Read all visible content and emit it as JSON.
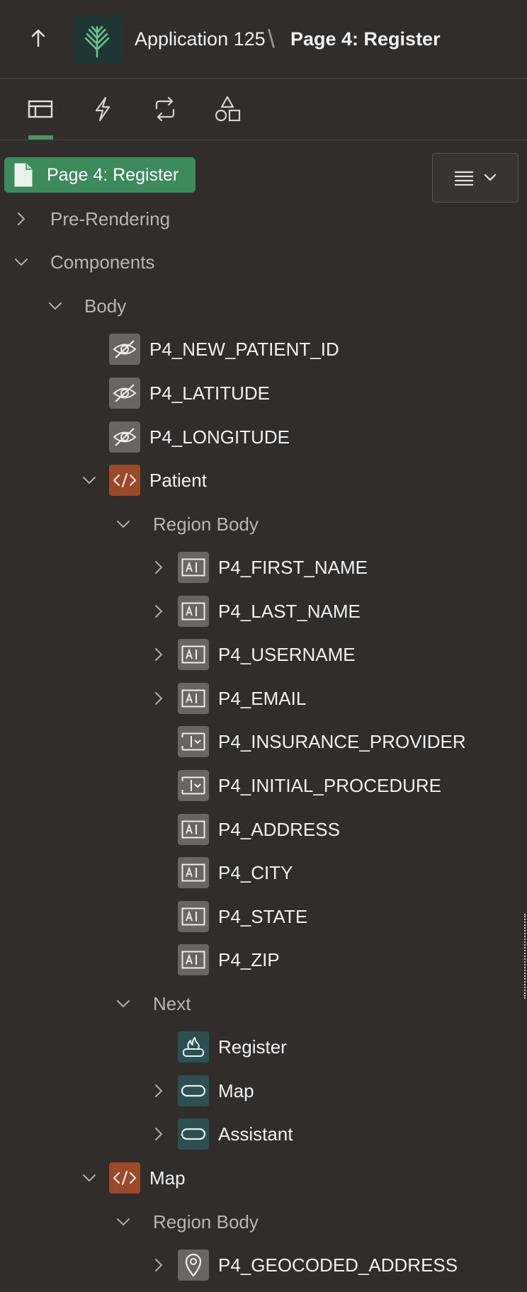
{
  "header": {
    "app_title": "Application 125",
    "separator": "\\",
    "page_title": "Page 4: Register",
    "up_icon": "arrow-up-icon",
    "logo_icon": "tree-logo-icon"
  },
  "tabs": [
    {
      "name": "rendering",
      "icon": "layout-icon",
      "active": true
    },
    {
      "name": "dynamic-actions",
      "icon": "lightning-icon",
      "active": false
    },
    {
      "name": "processing",
      "icon": "loop-icon",
      "active": false
    },
    {
      "name": "shared-components",
      "icon": "shapes-icon",
      "active": false
    }
  ],
  "root": {
    "label": "Page 4: Register",
    "icon": "page-icon"
  },
  "menu_button": {
    "icon": "menu-icon",
    "chevron": "chevron-down-icon"
  },
  "tree": [
    {
      "label": "Pre-Rendering"
    },
    {
      "label": "Components"
    },
    {
      "label": "Body"
    },
    {
      "label": "P4_NEW_PATIENT_ID"
    },
    {
      "label": "P4_LATITUDE"
    },
    {
      "label": "P4_LONGITUDE"
    },
    {
      "label": "Patient"
    },
    {
      "label": "Region Body"
    },
    {
      "label": "P4_FIRST_NAME"
    },
    {
      "label": "P4_LAST_NAME"
    },
    {
      "label": "P4_USERNAME"
    },
    {
      "label": "P4_EMAIL"
    },
    {
      "label": "P4_INSURANCE_PROVIDER"
    },
    {
      "label": "P4_INITIAL_PROCEDURE"
    },
    {
      "label": "P4_ADDRESS"
    },
    {
      "label": "P4_CITY"
    },
    {
      "label": "P4_STATE"
    },
    {
      "label": "P4_ZIP"
    },
    {
      "label": "Next"
    },
    {
      "label": "Register"
    },
    {
      "label": "Map"
    },
    {
      "label": "Assistant"
    },
    {
      "label": "Map"
    },
    {
      "label": "Region Body"
    },
    {
      "label": "P4_GEOCODED_ADDRESS"
    }
  ]
}
